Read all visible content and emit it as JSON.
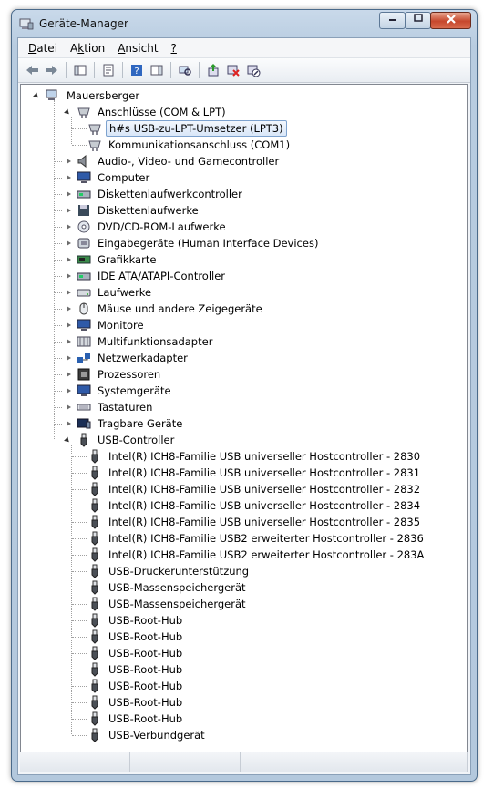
{
  "window": {
    "title": "Geräte-Manager"
  },
  "menu": [
    {
      "label": "Datei",
      "accel": "D"
    },
    {
      "label": "Aktion",
      "accel": "k"
    },
    {
      "label": "Ansicht",
      "accel": "A"
    },
    {
      "label": "?",
      "accel": "?"
    }
  ],
  "toolbar": [
    {
      "icon": "back-arrow-icon"
    },
    {
      "icon": "forward-arrow-icon"
    },
    {
      "sep": true
    },
    {
      "icon": "console-tree-icon"
    },
    {
      "sep": true
    },
    {
      "icon": "properties-icon"
    },
    {
      "sep": true
    },
    {
      "icon": "help-icon"
    },
    {
      "icon": "action-pane-icon"
    },
    {
      "sep": true
    },
    {
      "icon": "scan-hardware-icon"
    },
    {
      "sep": true
    },
    {
      "icon": "update-driver-icon"
    },
    {
      "icon": "uninstall-icon"
    },
    {
      "icon": "disable-device-icon"
    }
  ],
  "tree": [
    {
      "text": "Mauersberger",
      "level": 0,
      "state": "open",
      "icon": "computer"
    },
    {
      "text": "Anschlüsse (COM & LPT)",
      "level": 1,
      "state": "open",
      "icon": "port"
    },
    {
      "text": "h#s USB-zu-LPT-Umsetzer (LPT3)",
      "level": 2,
      "state": "leaf",
      "icon": "port",
      "selected": true
    },
    {
      "text": "Kommunikationsanschluss (COM1)",
      "level": 2,
      "state": "leaf",
      "icon": "port"
    },
    {
      "text": "Audio-, Video- und Gamecontroller",
      "level": 1,
      "state": "closed",
      "icon": "audio"
    },
    {
      "text": "Computer",
      "level": 1,
      "state": "closed",
      "icon": "monitor"
    },
    {
      "text": "Diskettenlaufwerkcontroller",
      "level": 1,
      "state": "closed",
      "icon": "controller"
    },
    {
      "text": "Diskettenlaufwerke",
      "level": 1,
      "state": "closed",
      "icon": "floppy"
    },
    {
      "text": "DVD/CD-ROM-Laufwerke",
      "level": 1,
      "state": "closed",
      "icon": "dvd"
    },
    {
      "text": "Eingabegeräte (Human Interface Devices)",
      "level": 1,
      "state": "closed",
      "icon": "hid"
    },
    {
      "text": "Grafikkarte",
      "level": 1,
      "state": "closed",
      "icon": "display"
    },
    {
      "text": "IDE ATA/ATAPI-Controller",
      "level": 1,
      "state": "closed",
      "icon": "controller"
    },
    {
      "text": "Laufwerke",
      "level": 1,
      "state": "closed",
      "icon": "drive"
    },
    {
      "text": "Mäuse und andere Zeigegeräte",
      "level": 1,
      "state": "closed",
      "icon": "mouse"
    },
    {
      "text": "Monitore",
      "level": 1,
      "state": "closed",
      "icon": "monitor"
    },
    {
      "text": "Multifunktionsadapter",
      "level": 1,
      "state": "closed",
      "icon": "multi"
    },
    {
      "text": "Netzwerkadapter",
      "level": 1,
      "state": "closed",
      "icon": "network"
    },
    {
      "text": "Prozessoren",
      "level": 1,
      "state": "closed",
      "icon": "cpu"
    },
    {
      "text": "Systemgeräte",
      "level": 1,
      "state": "closed",
      "icon": "monitor"
    },
    {
      "text": "Tastaturen",
      "level": 1,
      "state": "closed",
      "icon": "keyboard"
    },
    {
      "text": "Tragbare Geräte",
      "level": 1,
      "state": "closed",
      "icon": "portable"
    },
    {
      "text": "USB-Controller",
      "level": 1,
      "state": "open",
      "icon": "usb"
    },
    {
      "text": "Intel(R) ICH8-Familie USB universeller Hostcontroller - 2830",
      "level": 2,
      "state": "leaf",
      "icon": "usb"
    },
    {
      "text": "Intel(R) ICH8-Familie USB universeller Hostcontroller - 2831",
      "level": 2,
      "state": "leaf",
      "icon": "usb"
    },
    {
      "text": "Intel(R) ICH8-Familie USB universeller Hostcontroller - 2832",
      "level": 2,
      "state": "leaf",
      "icon": "usb"
    },
    {
      "text": "Intel(R) ICH8-Familie USB universeller Hostcontroller - 2834",
      "level": 2,
      "state": "leaf",
      "icon": "usb"
    },
    {
      "text": "Intel(R) ICH8-Familie USB universeller Hostcontroller - 2835",
      "level": 2,
      "state": "leaf",
      "icon": "usb"
    },
    {
      "text": "Intel(R) ICH8-Familie USB2 erweiterter Hostcontroller - 2836",
      "level": 2,
      "state": "leaf",
      "icon": "usb"
    },
    {
      "text": "Intel(R) ICH8-Familie USB2 erweiterter Hostcontroller - 283A",
      "level": 2,
      "state": "leaf",
      "icon": "usb"
    },
    {
      "text": "USB-Druckerunterstützung",
      "level": 2,
      "state": "leaf",
      "icon": "usb"
    },
    {
      "text": "USB-Massenspeichergerät",
      "level": 2,
      "state": "leaf",
      "icon": "usb"
    },
    {
      "text": "USB-Massenspeichergerät",
      "level": 2,
      "state": "leaf",
      "icon": "usb"
    },
    {
      "text": "USB-Root-Hub",
      "level": 2,
      "state": "leaf",
      "icon": "usb"
    },
    {
      "text": "USB-Root-Hub",
      "level": 2,
      "state": "leaf",
      "icon": "usb"
    },
    {
      "text": "USB-Root-Hub",
      "level": 2,
      "state": "leaf",
      "icon": "usb"
    },
    {
      "text": "USB-Root-Hub",
      "level": 2,
      "state": "leaf",
      "icon": "usb"
    },
    {
      "text": "USB-Root-Hub",
      "level": 2,
      "state": "leaf",
      "icon": "usb"
    },
    {
      "text": "USB-Root-Hub",
      "level": 2,
      "state": "leaf",
      "icon": "usb"
    },
    {
      "text": "USB-Root-Hub",
      "level": 2,
      "state": "leaf",
      "icon": "usb"
    },
    {
      "text": "USB-Verbundgerät",
      "level": 2,
      "state": "leaf",
      "icon": "usb"
    }
  ]
}
